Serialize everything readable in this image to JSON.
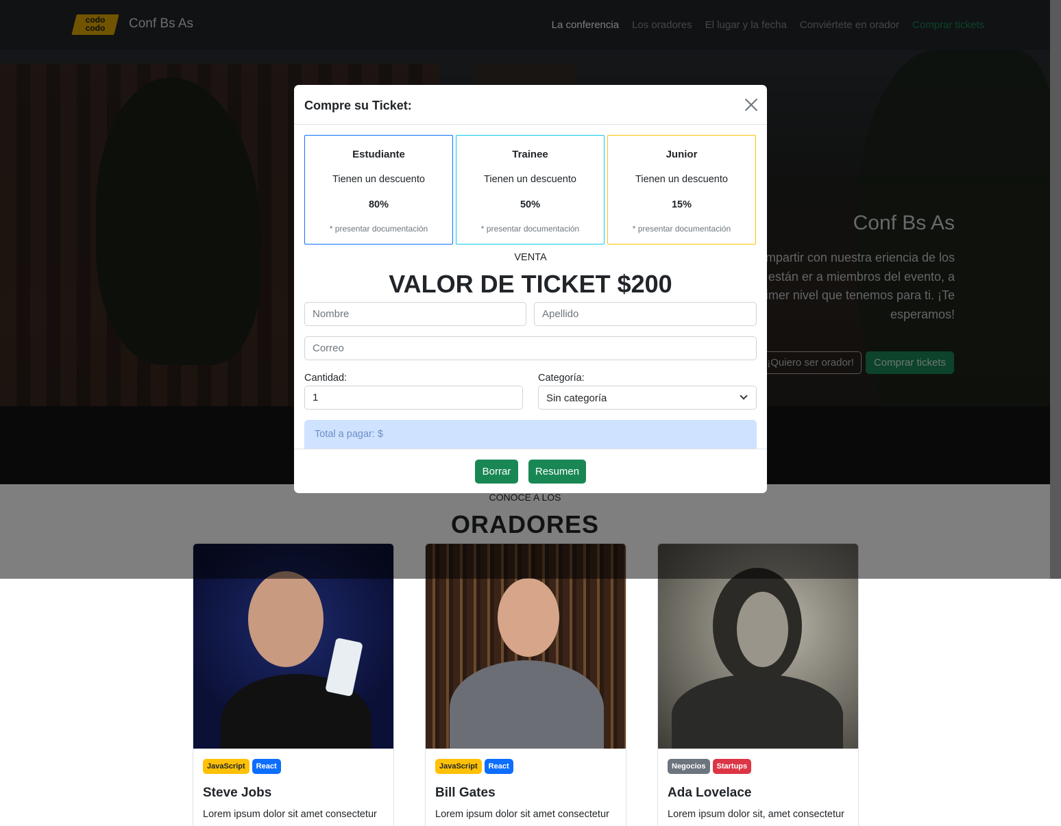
{
  "navbar": {
    "logo_text": "codo codo",
    "brand": "Conf Bs As",
    "links": [
      "La conferencia",
      "Los oradores",
      "El lugar y la fecha",
      "Conviértete en orador",
      "Comprar tickets"
    ]
  },
  "hero": {
    "title": "Conf Bs As",
    "description": "evento para compartir con nuestra eriencia de los expertos que están er a miembros del evento, a otros ores del primer nivel que tenemos para ti. ¡Te esperamos!",
    "btn_speaker": "¡Quiero ser orador!",
    "btn_buy": "Comprar tickets"
  },
  "speakers_section": {
    "subtitle": "CONOCE A LOS",
    "title": "ORADORES"
  },
  "speakers": [
    {
      "name": "Steve Jobs",
      "tags": [
        "JavaScript",
        "React"
      ],
      "desc": "Lorem ipsum dolor sit amet consectetur"
    },
    {
      "name": "Bill Gates",
      "tags": [
        "JavaScript",
        "React"
      ],
      "desc": "Lorem ipsum dolor sit amet consectetur"
    },
    {
      "name": "Ada Lovelace",
      "tags": [
        "Negocios",
        "Startups"
      ],
      "desc": "Lorem ipsum dolor sit, amet consectetur"
    }
  ],
  "modal": {
    "title": "Compre su Ticket:",
    "tiers": [
      {
        "name": "Estudiante",
        "desc": "Tienen un descuento",
        "pct": "80%",
        "note": "* presentar documentación"
      },
      {
        "name": "Trainee",
        "desc": "Tienen un descuento",
        "pct": "50%",
        "note": "* presentar documentación"
      },
      {
        "name": "Junior",
        "desc": "Tienen un descuento",
        "pct": "15%",
        "note": "* presentar documentación"
      }
    ],
    "venta": "VENTA",
    "price": "VALOR DE TICKET $200",
    "form": {
      "nombre_placeholder": "Nombre",
      "apellido_placeholder": "Apellido",
      "correo_placeholder": "Correo",
      "cantidad_label": "Cantidad:",
      "cantidad_value": "1",
      "categoria_label": "Categoría:",
      "categoria_value": "Sin categoría"
    },
    "total": "Total a pagar: $",
    "btn_borrar": "Borrar",
    "btn_resumen": "Resumen"
  },
  "colors": {
    "navbar_bg": "#212529",
    "accent_green": "#198754",
    "tier_estudiante": "#0d6efd",
    "tier_trainee": "#0dcaf0",
    "tier_junior": "#ffc107",
    "total_bg": "#cfe2ff"
  }
}
